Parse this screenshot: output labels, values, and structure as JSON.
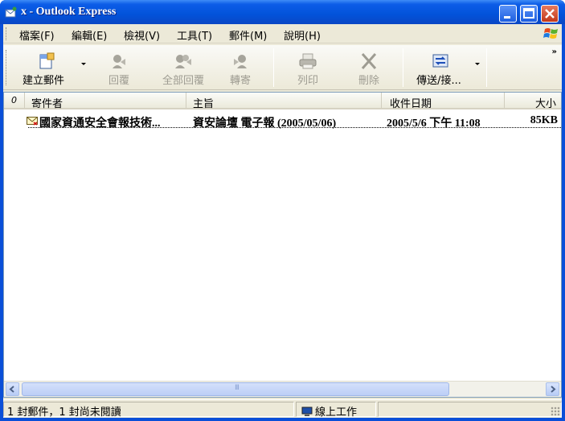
{
  "window": {
    "title": "x - Outlook Express"
  },
  "menu": [
    "檔案(F)",
    "編輯(E)",
    "檢視(V)",
    "工具(T)",
    "郵件(M)",
    "說明(H)"
  ],
  "toolbar": {
    "compose": "建立郵件",
    "reply": "回覆",
    "reply_all": "全部回覆",
    "forward": "轉寄",
    "print": "列印",
    "delete": "刪除",
    "send_receive": "傳送/接...",
    "overflow": "»"
  },
  "columns": {
    "attachment": "0",
    "from": "寄件者",
    "subject": "主旨",
    "received": "收件日期",
    "size": "大小"
  },
  "messages": [
    {
      "from": "國家資通安全會報技術...",
      "subject": "資安論壇 電子報 (2005/05/06)",
      "received": "2005/5/6 下午 11:08",
      "size": "85KB",
      "unread": true
    }
  ],
  "scroll": {
    "thumb_glyph": "III"
  },
  "status": {
    "count": "1 封郵件，1 封尚未閱讀",
    "connection": "線上工作"
  }
}
